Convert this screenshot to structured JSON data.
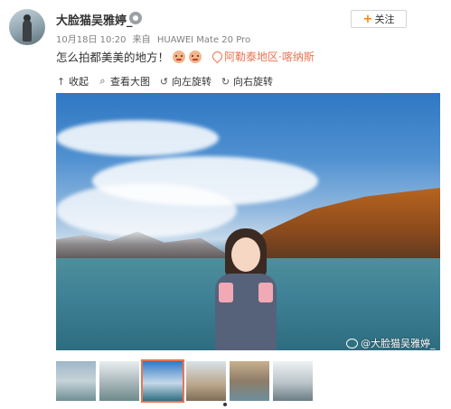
{
  "user": {
    "name": "大脸猫吴雅婷_",
    "follow_label": "关注",
    "follow_plus": "+"
  },
  "meta": {
    "time": "10月18日 10:20",
    "source_prefix": "来自",
    "device": "HUAWEI Mate 20 Pro"
  },
  "post": {
    "text": "怎么拍都美美的地方！",
    "location": "阿勒泰地区·喀纳斯"
  },
  "toolbar": {
    "collapse": "收起",
    "view_large": "查看大图",
    "rotate_left": "向左旋转",
    "rotate_right": "向右旋转"
  },
  "photo": {
    "watermark": "@大脸猫吴雅婷_"
  },
  "thumbnails": [
    {
      "bg": "linear-gradient(180deg,#9fb7c9 0%,#c6d3d8 50%,#6f8f95 100%)"
    },
    {
      "bg": "linear-gradient(180deg,#e9eef0 0%,#a7b5b9 55%,#6d8a8a 100%)"
    },
    {
      "bg": "linear-gradient(180deg,#2f78c4 0%,#c5d9ea 55%,#2f6f80 100%)",
      "active": true
    },
    {
      "bg": "linear-gradient(180deg,#d9e2e8 0%,#b9a58a 60%,#7f6d57 100%)"
    },
    {
      "bg": "linear-gradient(180deg,#c9b08e 0%,#8e7c68 50%,#6d8f9d 100%)"
    },
    {
      "bg": "linear-gradient(180deg,#eef2f4 0%,#b9c4c9 55%,#6a7d83 100%)"
    }
  ],
  "colors": {
    "accent_orange": "#ff8200",
    "location": "#eb7350",
    "meta_gray": "#808080"
  }
}
